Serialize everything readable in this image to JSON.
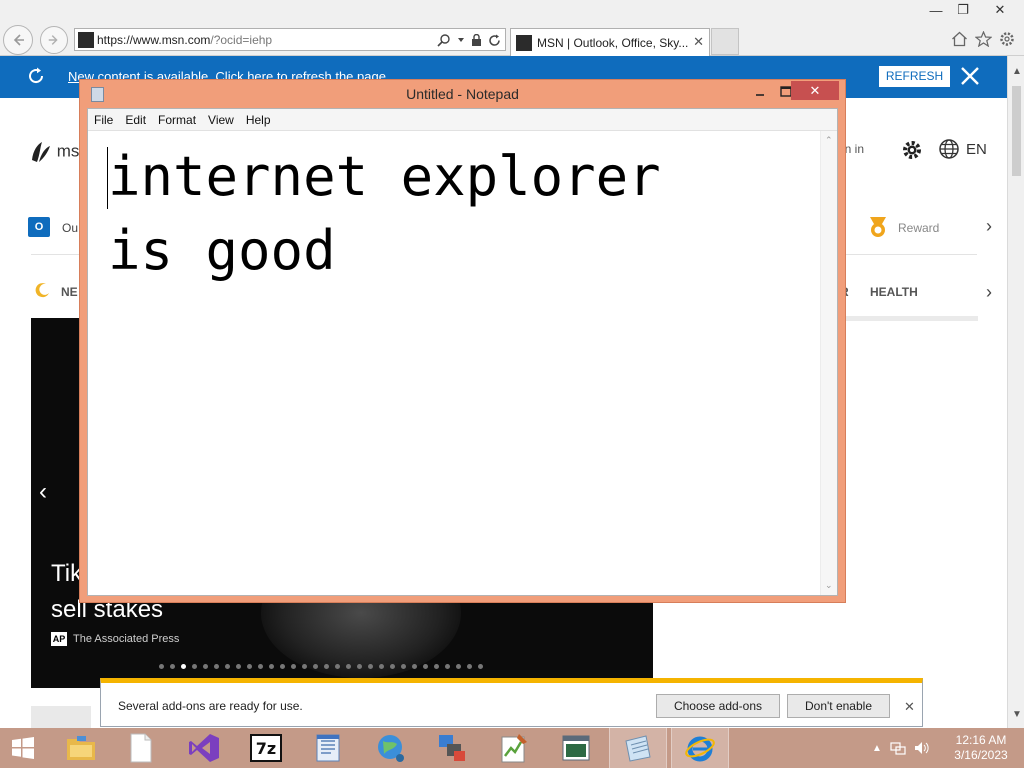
{
  "browser": {
    "url_host": "https://www.msn.com",
    "url_path": "/?ocid=iehp",
    "tab_title": "MSN | Outlook, Office, Sky...",
    "window_controls": {
      "minimize": "—",
      "restore": "❐",
      "close": "✕"
    }
  },
  "msn": {
    "notification_text": "New content is available. Click here to refresh the page.",
    "refresh_label": "REFRESH",
    "logo_text": "msn",
    "signin_label": "gn in",
    "language": "EN",
    "outlook_label": "Ou",
    "rewards_label": "Rewards",
    "nav_news_label": "NE",
    "nav_partial_label": "R",
    "nav_health_label": "HEALTH",
    "hero": {
      "headline": "TikTok ... sell stakes",
      "headline_line1": "Tik",
      "headline_line2": "sell stakes",
      "source_badge": "AP",
      "source": "The Associated Press",
      "slide_count": 30,
      "active_slide": 2
    }
  },
  "notepad": {
    "title": "Untitled - Notepad",
    "menu": [
      "File",
      "Edit",
      "Format",
      "View",
      "Help"
    ],
    "content_lines": [
      "internet explorer",
      "is good"
    ]
  },
  "addon_bar": {
    "message": "Several add-ons are ready for use.",
    "choose_label": "Choose add-ons",
    "dont_enable_label": "Don't enable"
  },
  "taskbar": {
    "time": "12:16 AM",
    "date": "3/16/2023",
    "apps": [
      "start",
      "file-explorer",
      "blank-document",
      "visual-studio",
      "7-zip",
      "wordpad",
      "paint-3d",
      "network-tool",
      "notepad-plus-plus",
      "terminal",
      "notepad",
      "internet-explorer"
    ]
  },
  "colors": {
    "msn_blue": "#0f6cbd",
    "notepad_border": "#f19e7a",
    "taskbar": "#c49a88",
    "addon_accent": "#f5b400",
    "close_red": "#c75050"
  }
}
